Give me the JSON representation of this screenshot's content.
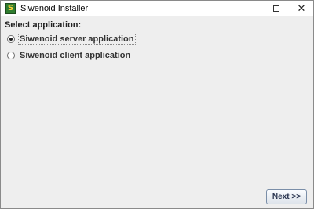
{
  "window": {
    "title": "Siwenoid Installer",
    "icon": "siwenoid-app-icon",
    "controls": {
      "minimize_icon": "minimize-icon",
      "maximize_icon": "maximize-icon",
      "close_icon": "close-icon",
      "close_glyph": "✕"
    }
  },
  "main": {
    "heading": "Select application:",
    "options": [
      {
        "label": "Siwenoid server application",
        "selected": true
      },
      {
        "label": "Siwenoid client application",
        "selected": false
      }
    ],
    "next_button": "Next >>"
  },
  "colors": {
    "window_background": "#eeeeee",
    "titlebar_background": "#ffffff",
    "button_border": "#7a8ea8"
  }
}
